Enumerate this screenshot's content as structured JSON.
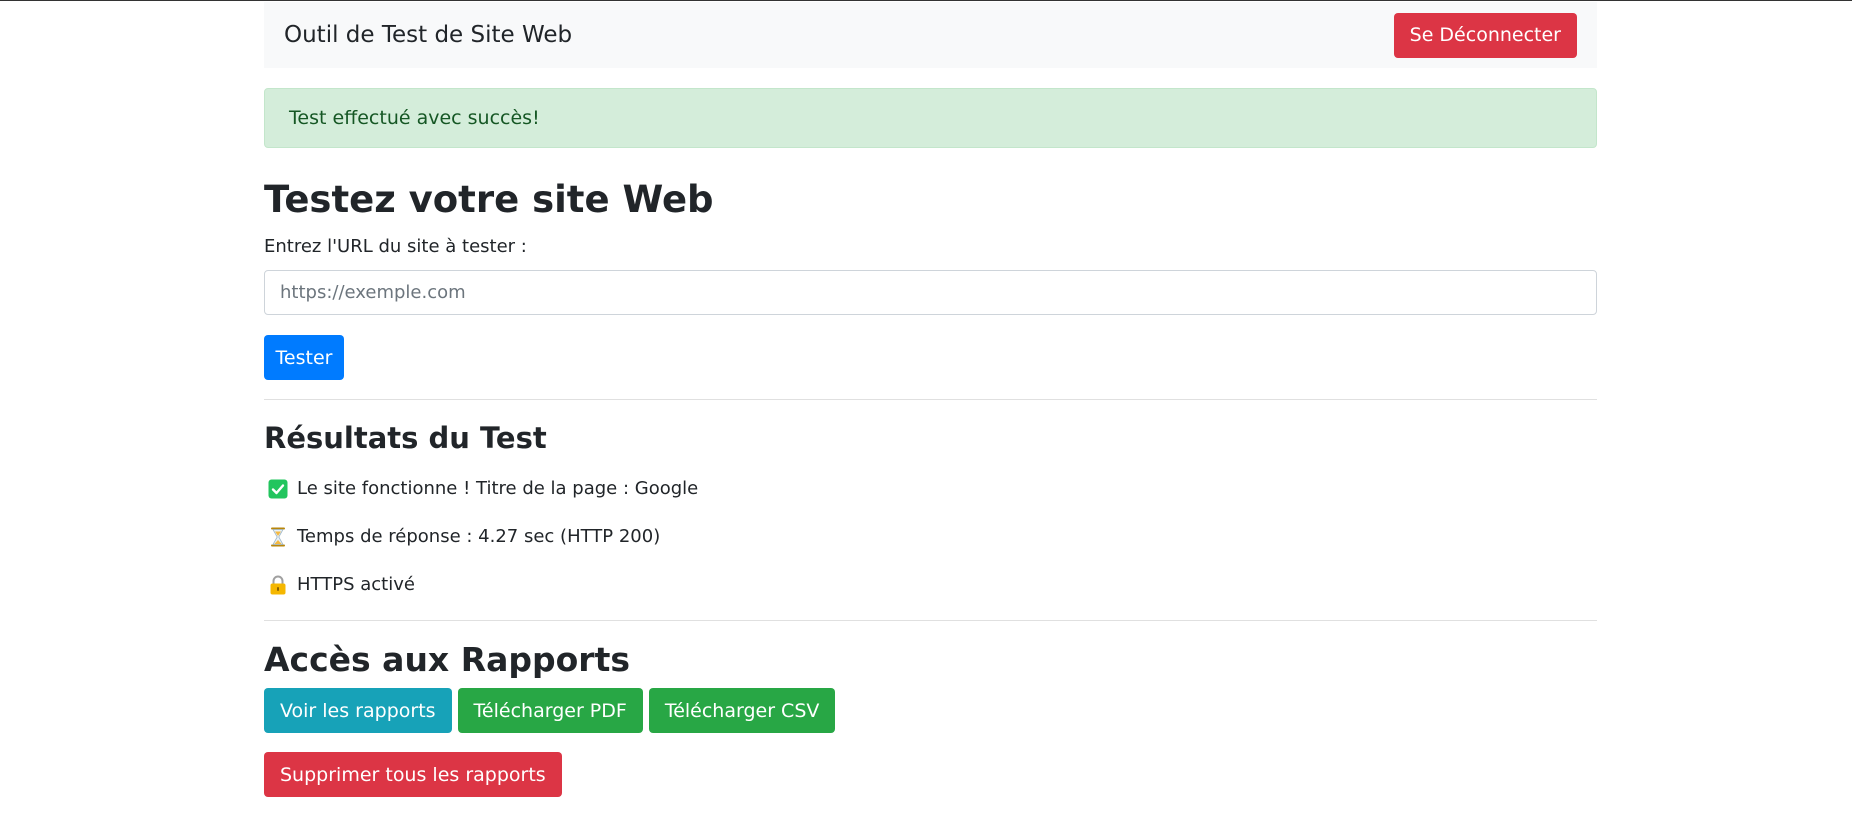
{
  "navbar": {
    "brand": "Outil de Test de Site Web",
    "logout_label": "Se Déconnecter"
  },
  "alert": {
    "message": "Test effectué avec succès!"
  },
  "tester": {
    "heading": "Testez votre site Web",
    "url_label": "Entrez l'URL du site à tester :",
    "url_placeholder": "https://exemple.com",
    "url_value": "",
    "submit_label": "Tester"
  },
  "results": {
    "heading": "Résultats du Test",
    "items": [
      {
        "icon": "check-icon",
        "text": "Le site fonctionne ! Titre de la page : Google"
      },
      {
        "icon": "hourglass-icon",
        "text": "Temps de réponse : 4.27 sec (HTTP 200)"
      },
      {
        "icon": "lock-icon",
        "text": "HTTPS activé"
      }
    ]
  },
  "reports": {
    "heading": "Accès aux Rapports",
    "view_label": "Voir les rapports",
    "pdf_label": "Télécharger PDF",
    "csv_label": "Télécharger CSV",
    "delete_label": "Supprimer tous les rapports"
  },
  "colors": {
    "danger": "#dc3545",
    "primary": "#007bff",
    "info": "#17a2b8",
    "success": "#28a745",
    "alert_bg": "#d4edda"
  }
}
